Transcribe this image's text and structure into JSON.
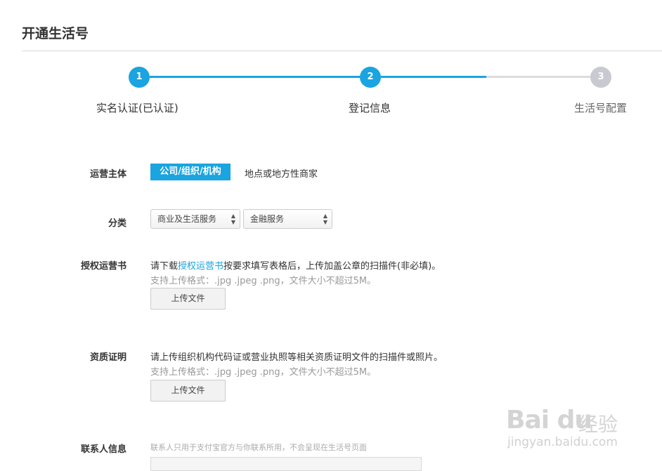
{
  "page": {
    "title": "开通生活号"
  },
  "steps": [
    {
      "number": "1",
      "label": "实名认证(已认证)",
      "state": "done"
    },
    {
      "number": "2",
      "label": "登记信息",
      "state": "current"
    },
    {
      "number": "3",
      "label": "生活号配置",
      "state": "pending"
    }
  ],
  "form": {
    "operator": {
      "label": "运营主体",
      "options": [
        "公司/组织/机构",
        "地点或地方性商家"
      ],
      "selected": "公司/组织/机构"
    },
    "category": {
      "label": "分类",
      "primary_value": "商业及生活服务",
      "secondary_value": "金融服务"
    },
    "authorization": {
      "label": "授权运营书",
      "desc_prefix": "请下载",
      "desc_link": "授权运营书",
      "desc_suffix": "按要求填写表格后，上传加盖公章的扫描件(非必填)。",
      "hint": "支持上传格式：.jpg .jpeg .png，文件大小不超过5M。",
      "upload_label": "上传文件"
    },
    "qualification": {
      "label": "资质证明",
      "desc": "请上传组织机构代码证或营业执照等相关资质证明文件的扫描件或照片。",
      "hint": "支持上传格式：.jpg .jpeg .png，文件大小不超过5M。",
      "upload_label": "上传文件"
    },
    "contact": {
      "label": "联系人信息",
      "hint": "联系人只用于支付宝官方与你联系所用，不会呈现在生活号页面"
    }
  },
  "watermark": {
    "logo": "Bai du",
    "text": "经验",
    "url": "jingyan.baidu.com"
  },
  "colors": {
    "accent": "#1aa4e0",
    "inactive_step": "#c9c9d1"
  }
}
